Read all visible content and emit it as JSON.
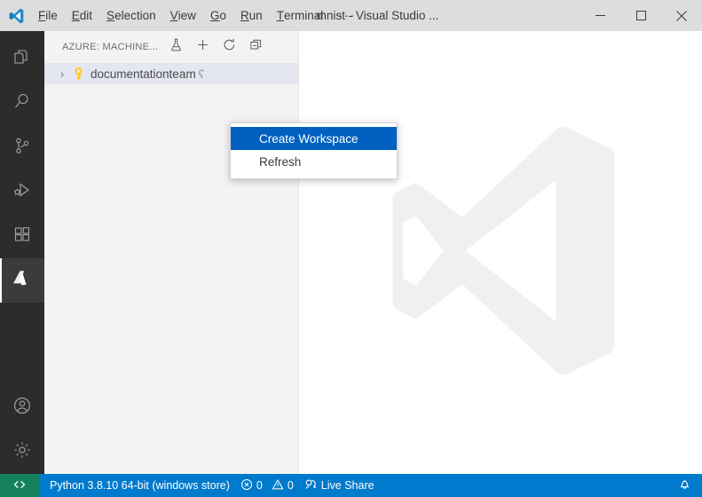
{
  "titlebar": {
    "logo_icon": "vscode-logo-icon",
    "menus": [
      {
        "mnemonic": "F",
        "rest": "ile"
      },
      {
        "mnemonic": "E",
        "rest": "dit"
      },
      {
        "mnemonic": "S",
        "rest": "election"
      },
      {
        "mnemonic": "V",
        "rest": "iew"
      },
      {
        "mnemonic": "G",
        "rest": "o"
      },
      {
        "mnemonic": "R",
        "rest": "un"
      },
      {
        "mnemonic": "T",
        "rest": "erminal"
      }
    ],
    "more_label": "···",
    "window_title": "mnist - Visual Studio ...",
    "minimize_label": "─",
    "maximize_label": "☐",
    "close_label": "✕"
  },
  "activitybar": {
    "items": [
      {
        "name": "explorer",
        "icon": "files-icon",
        "active": false
      },
      {
        "name": "search",
        "icon": "search-icon",
        "active": false
      },
      {
        "name": "source-control",
        "icon": "source-control-icon",
        "active": false
      },
      {
        "name": "run-and-debug",
        "icon": "run-debug-icon",
        "active": false
      },
      {
        "name": "extensions",
        "icon": "extensions-icon",
        "active": false
      },
      {
        "name": "azure",
        "icon": "azure-icon",
        "active": true
      }
    ],
    "bottom_items": [
      {
        "name": "accounts",
        "icon": "account-icon"
      },
      {
        "name": "manage",
        "icon": "gear-icon"
      }
    ]
  },
  "sidebar": {
    "title": "AZURE: MACHINE...",
    "actions": [
      {
        "name": "create-experiment",
        "icon": "flask-icon",
        "glyph": "flask"
      },
      {
        "name": "add",
        "icon": "plus-icon",
        "glyph": "plus"
      },
      {
        "name": "refresh",
        "icon": "refresh-icon",
        "glyph": "refresh"
      },
      {
        "name": "collapse-all",
        "icon": "collapse-all-icon",
        "glyph": "collapse"
      }
    ],
    "tree": {
      "twisty": "›",
      "item_icon": "key-icon",
      "item_label": "documentationteam",
      "item_suffix": "ʕ",
      "filter_icon": "filter-triangle-icon"
    }
  },
  "editor": {
    "watermark_icon": "vscode-watermark-logo"
  },
  "context_menu": {
    "items": [
      {
        "label": "Create Workspace",
        "selected": true
      },
      {
        "label": "Refresh",
        "selected": false
      }
    ]
  },
  "statusbar": {
    "remote_icon": "remote-window-icon",
    "python_label": "Python 3.8.10 64-bit (windows store)",
    "errors_icon": "error-icon",
    "errors_count": "0",
    "warnings_icon": "warning-icon",
    "warnings_count": "0",
    "live_share_icon": "live-share-icon",
    "live_share_label": "Live Share",
    "notifications_icon": "bell-icon"
  },
  "colors": {
    "accent": "#007acc",
    "menu_highlight": "#0060c0",
    "remote_green": "#16825d",
    "titlebar_bg": "#dddddd",
    "sidebar_bg": "#f3f3f3",
    "activitybar_bg": "#2c2c2c",
    "tree_selected_bg": "#e4e6f1",
    "key_yellow": "#ffc70a"
  }
}
